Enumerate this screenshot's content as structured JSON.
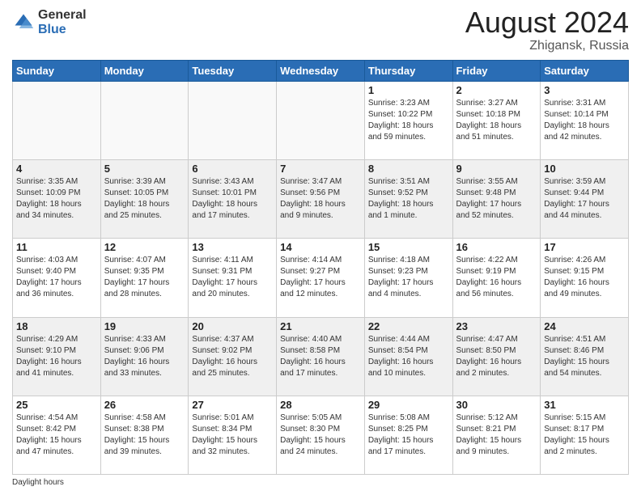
{
  "logo": {
    "general": "General",
    "blue": "Blue"
  },
  "title": "August 2024",
  "subtitle": "Zhigansk, Russia",
  "days_of_week": [
    "Sunday",
    "Monday",
    "Tuesday",
    "Wednesday",
    "Thursday",
    "Friday",
    "Saturday"
  ],
  "footer_note": "Daylight hours",
  "weeks": [
    [
      {
        "day": "",
        "sunrise": "",
        "sunset": "",
        "daylight": "",
        "empty": true
      },
      {
        "day": "",
        "sunrise": "",
        "sunset": "",
        "daylight": "",
        "empty": true
      },
      {
        "day": "",
        "sunrise": "",
        "sunset": "",
        "daylight": "",
        "empty": true
      },
      {
        "day": "",
        "sunrise": "",
        "sunset": "",
        "daylight": "",
        "empty": true
      },
      {
        "day": "1",
        "sunrise": "Sunrise: 3:23 AM",
        "sunset": "Sunset: 10:22 PM",
        "daylight": "Daylight: 18 hours and 59 minutes.",
        "empty": false
      },
      {
        "day": "2",
        "sunrise": "Sunrise: 3:27 AM",
        "sunset": "Sunset: 10:18 PM",
        "daylight": "Daylight: 18 hours and 51 minutes.",
        "empty": false
      },
      {
        "day": "3",
        "sunrise": "Sunrise: 3:31 AM",
        "sunset": "Sunset: 10:14 PM",
        "daylight": "Daylight: 18 hours and 42 minutes.",
        "empty": false
      }
    ],
    [
      {
        "day": "4",
        "sunrise": "Sunrise: 3:35 AM",
        "sunset": "Sunset: 10:09 PM",
        "daylight": "Daylight: 18 hours and 34 minutes.",
        "empty": false
      },
      {
        "day": "5",
        "sunrise": "Sunrise: 3:39 AM",
        "sunset": "Sunset: 10:05 PM",
        "daylight": "Daylight: 18 hours and 25 minutes.",
        "empty": false
      },
      {
        "day": "6",
        "sunrise": "Sunrise: 3:43 AM",
        "sunset": "Sunset: 10:01 PM",
        "daylight": "Daylight: 18 hours and 17 minutes.",
        "empty": false
      },
      {
        "day": "7",
        "sunrise": "Sunrise: 3:47 AM",
        "sunset": "Sunset: 9:56 PM",
        "daylight": "Daylight: 18 hours and 9 minutes.",
        "empty": false
      },
      {
        "day": "8",
        "sunrise": "Sunrise: 3:51 AM",
        "sunset": "Sunset: 9:52 PM",
        "daylight": "Daylight: 18 hours and 1 minute.",
        "empty": false
      },
      {
        "day": "9",
        "sunrise": "Sunrise: 3:55 AM",
        "sunset": "Sunset: 9:48 PM",
        "daylight": "Daylight: 17 hours and 52 minutes.",
        "empty": false
      },
      {
        "day": "10",
        "sunrise": "Sunrise: 3:59 AM",
        "sunset": "Sunset: 9:44 PM",
        "daylight": "Daylight: 17 hours and 44 minutes.",
        "empty": false
      }
    ],
    [
      {
        "day": "11",
        "sunrise": "Sunrise: 4:03 AM",
        "sunset": "Sunset: 9:40 PM",
        "daylight": "Daylight: 17 hours and 36 minutes.",
        "empty": false
      },
      {
        "day": "12",
        "sunrise": "Sunrise: 4:07 AM",
        "sunset": "Sunset: 9:35 PM",
        "daylight": "Daylight: 17 hours and 28 minutes.",
        "empty": false
      },
      {
        "day": "13",
        "sunrise": "Sunrise: 4:11 AM",
        "sunset": "Sunset: 9:31 PM",
        "daylight": "Daylight: 17 hours and 20 minutes.",
        "empty": false
      },
      {
        "day": "14",
        "sunrise": "Sunrise: 4:14 AM",
        "sunset": "Sunset: 9:27 PM",
        "daylight": "Daylight: 17 hours and 12 minutes.",
        "empty": false
      },
      {
        "day": "15",
        "sunrise": "Sunrise: 4:18 AM",
        "sunset": "Sunset: 9:23 PM",
        "daylight": "Daylight: 17 hours and 4 minutes.",
        "empty": false
      },
      {
        "day": "16",
        "sunrise": "Sunrise: 4:22 AM",
        "sunset": "Sunset: 9:19 PM",
        "daylight": "Daylight: 16 hours and 56 minutes.",
        "empty": false
      },
      {
        "day": "17",
        "sunrise": "Sunrise: 4:26 AM",
        "sunset": "Sunset: 9:15 PM",
        "daylight": "Daylight: 16 hours and 49 minutes.",
        "empty": false
      }
    ],
    [
      {
        "day": "18",
        "sunrise": "Sunrise: 4:29 AM",
        "sunset": "Sunset: 9:10 PM",
        "daylight": "Daylight: 16 hours and 41 minutes.",
        "empty": false
      },
      {
        "day": "19",
        "sunrise": "Sunrise: 4:33 AM",
        "sunset": "Sunset: 9:06 PM",
        "daylight": "Daylight: 16 hours and 33 minutes.",
        "empty": false
      },
      {
        "day": "20",
        "sunrise": "Sunrise: 4:37 AM",
        "sunset": "Sunset: 9:02 PM",
        "daylight": "Daylight: 16 hours and 25 minutes.",
        "empty": false
      },
      {
        "day": "21",
        "sunrise": "Sunrise: 4:40 AM",
        "sunset": "Sunset: 8:58 PM",
        "daylight": "Daylight: 16 hours and 17 minutes.",
        "empty": false
      },
      {
        "day": "22",
        "sunrise": "Sunrise: 4:44 AM",
        "sunset": "Sunset: 8:54 PM",
        "daylight": "Daylight: 16 hours and 10 minutes.",
        "empty": false
      },
      {
        "day": "23",
        "sunrise": "Sunrise: 4:47 AM",
        "sunset": "Sunset: 8:50 PM",
        "daylight": "Daylight: 16 hours and 2 minutes.",
        "empty": false
      },
      {
        "day": "24",
        "sunrise": "Sunrise: 4:51 AM",
        "sunset": "Sunset: 8:46 PM",
        "daylight": "Daylight: 15 hours and 54 minutes.",
        "empty": false
      }
    ],
    [
      {
        "day": "25",
        "sunrise": "Sunrise: 4:54 AM",
        "sunset": "Sunset: 8:42 PM",
        "daylight": "Daylight: 15 hours and 47 minutes.",
        "empty": false
      },
      {
        "day": "26",
        "sunrise": "Sunrise: 4:58 AM",
        "sunset": "Sunset: 8:38 PM",
        "daylight": "Daylight: 15 hours and 39 minutes.",
        "empty": false
      },
      {
        "day": "27",
        "sunrise": "Sunrise: 5:01 AM",
        "sunset": "Sunset: 8:34 PM",
        "daylight": "Daylight: 15 hours and 32 minutes.",
        "empty": false
      },
      {
        "day": "28",
        "sunrise": "Sunrise: 5:05 AM",
        "sunset": "Sunset: 8:30 PM",
        "daylight": "Daylight: 15 hours and 24 minutes.",
        "empty": false
      },
      {
        "day": "29",
        "sunrise": "Sunrise: 5:08 AM",
        "sunset": "Sunset: 8:25 PM",
        "daylight": "Daylight: 15 hours and 17 minutes.",
        "empty": false
      },
      {
        "day": "30",
        "sunrise": "Sunrise: 5:12 AM",
        "sunset": "Sunset: 8:21 PM",
        "daylight": "Daylight: 15 hours and 9 minutes.",
        "empty": false
      },
      {
        "day": "31",
        "sunrise": "Sunrise: 5:15 AM",
        "sunset": "Sunset: 8:17 PM",
        "daylight": "Daylight: 15 hours and 2 minutes.",
        "empty": false
      }
    ]
  ]
}
